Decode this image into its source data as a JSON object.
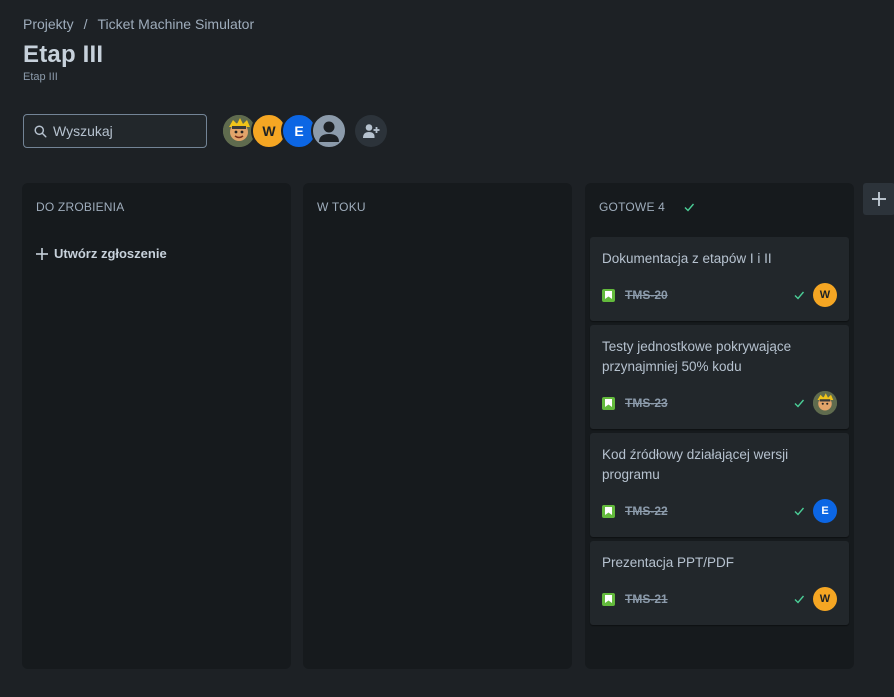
{
  "breadcrumb": {
    "projects": "Projekty",
    "separator": "/",
    "project": "Ticket Machine Simulator"
  },
  "page": {
    "title": "Etap III",
    "subtitle": "Etap III"
  },
  "search": {
    "placeholder": "Wyszukaj",
    "value": ""
  },
  "avatars": {
    "w": "W",
    "e": "E"
  },
  "columns": {
    "todo": {
      "title": "DO ZROBIENIA",
      "create_label": "Utwórz zgłoszenie"
    },
    "in_progress": {
      "title": "W TOKU"
    },
    "done": {
      "title": "GOTOWE 4"
    }
  },
  "cards": [
    {
      "title": "Dokumentacja z etapów I i II",
      "key": "TMS-20",
      "assignee": "W",
      "assignee_color": "#f5a623"
    },
    {
      "title": "Testy jednostkowe pokrywające przynajmniej 50% kodu",
      "key": "TMS-23",
      "assignee": "",
      "assignee_color": "#6d7a58"
    },
    {
      "title": "Kod źródłowy działającej wersji programu",
      "key": "TMS-22",
      "assignee": "E",
      "assignee_color": "#0c66e4"
    },
    {
      "title": "Prezentacja PPT/PDF",
      "key": "TMS-21",
      "assignee": "W",
      "assignee_color": "#f5a623"
    }
  ],
  "colors": {
    "background": "#1d2125",
    "column": "#161a1d",
    "card": "#22272b",
    "done_check": "#4bce97",
    "story_icon": "#63ba3c"
  },
  "icons": {
    "search": "search-icon",
    "add_people": "add-people-icon",
    "plus": "plus-icon",
    "check": "check-icon",
    "story": "story-icon"
  }
}
